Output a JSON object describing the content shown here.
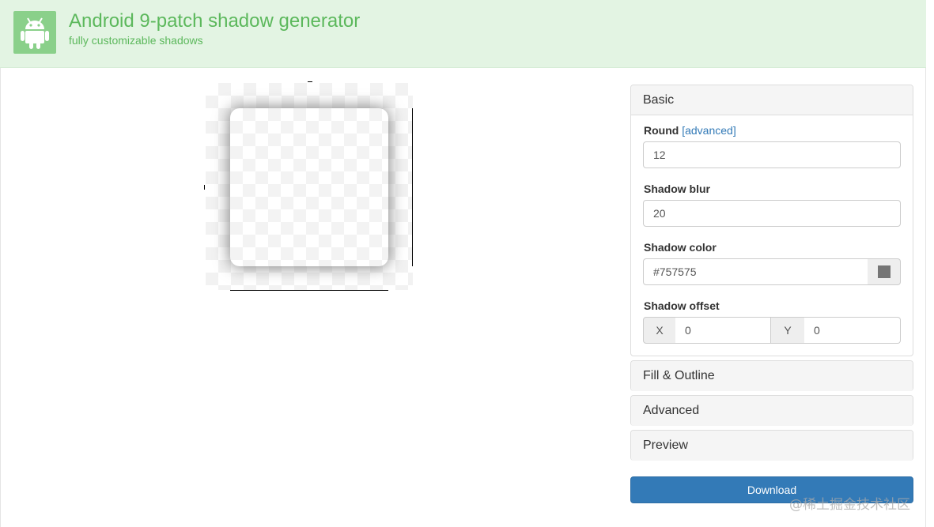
{
  "header": {
    "title": "Android 9-patch shadow generator",
    "subtitle": "fully customizable shadows",
    "logo_icon": "android-robot-icon",
    "accent_color": "#5cb85c"
  },
  "basic": {
    "heading": "Basic",
    "round_label": "Round",
    "round_link": "[advanced]",
    "round_value": "12",
    "blur_label": "Shadow blur",
    "blur_value": "20",
    "color_label": "Shadow color",
    "color_value": "#757575",
    "offset_label": "Shadow offset",
    "offset_x_label": "X",
    "offset_x_value": "0",
    "offset_y_label": "Y",
    "offset_y_value": "0"
  },
  "panels": {
    "fill": "Fill & Outline",
    "advanced": "Advanced",
    "preview": "Preview"
  },
  "download_label": "Download",
  "download_color": "#337ab7",
  "watermark": "@稀土掘金技术社区"
}
